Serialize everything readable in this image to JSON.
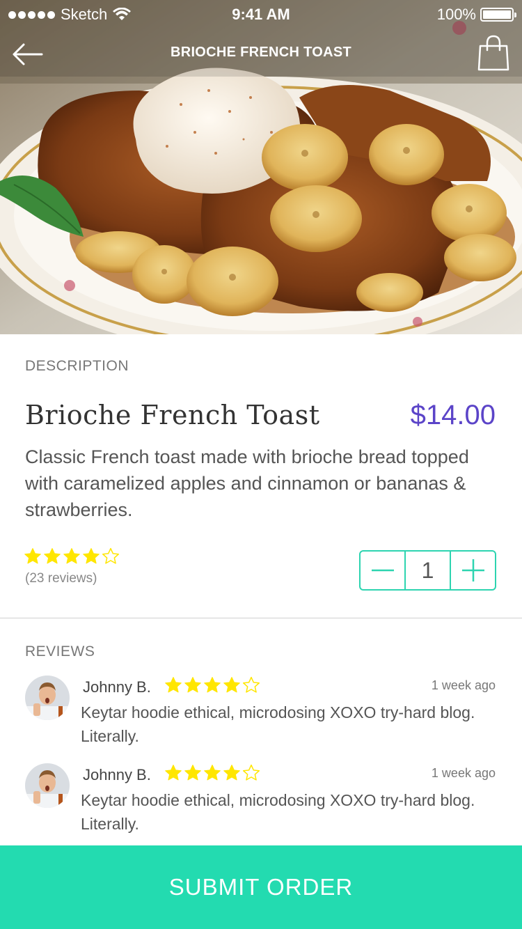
{
  "status_bar": {
    "carrier": "Sketch",
    "time": "9:41 AM",
    "battery": "100%",
    "battery_level": 1.0
  },
  "nav": {
    "title": "BRIOCHE FRENCH TOAST",
    "back_icon": "arrow-left-icon",
    "bag_icon": "shopping-bag-icon"
  },
  "description": {
    "section_label": "DESCRIPTION",
    "dish_name": "Brioche French Toast",
    "price": "$14.00",
    "text": "Classic French toast made with brioche bread topped with caramelized apples and cinnamon or bananas & strawberries.",
    "rating": 4,
    "rating_max": 5,
    "review_count": "(23 reviews)",
    "quantity": "1"
  },
  "reviews": {
    "section_label": "REVIEWS",
    "items": [
      {
        "name": "Johnny B.",
        "rating": 4,
        "time": "1 week ago",
        "text": "Keytar hoodie ethical, microdosing XOXO try-hard blog. Literally."
      },
      {
        "name": "Johnny B.",
        "rating": 4,
        "time": "1 week ago",
        "text": "Keytar hoodie ethical, microdosing XOXO try-hard blog. Literally."
      }
    ]
  },
  "actions": {
    "submit_label": "SUBMIT ORDER"
  },
  "colors": {
    "accent": "#23dbb0",
    "price": "#5b44c8",
    "star": "#ffe600",
    "stepper_border": "#2dd4b0"
  }
}
